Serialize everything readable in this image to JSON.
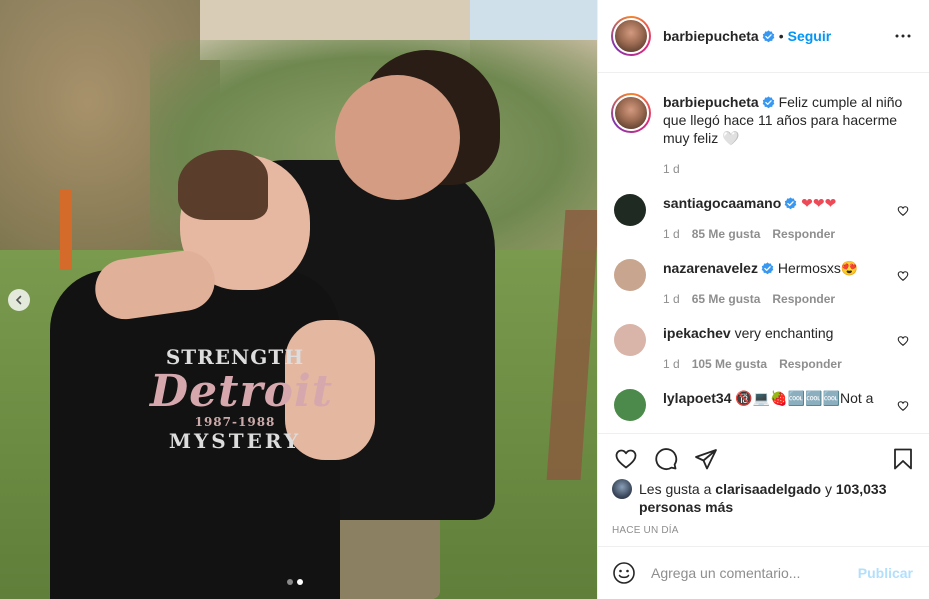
{
  "post": {
    "author": "barbiepucheta",
    "follow_label": "Seguir",
    "separator": "•",
    "caption": "Feliz cumple al niño que llegó hace 11 años para hacerme muy feliz 🤍",
    "caption_time": "1 d",
    "photo": {
      "shirt_line1": "STRENGTH",
      "shirt_line2": "Detroit",
      "shirt_line3": "1987-1988",
      "shirt_line4": "MYSTERY",
      "current_slide": 2,
      "total_slides": 2
    }
  },
  "comments": [
    {
      "user": "santiagocaamano",
      "verified": true,
      "text": "❤❤❤",
      "time": "1 d",
      "likes": "85 Me gusta",
      "reply": "Responder",
      "avatar_color": "#1f2a22"
    },
    {
      "user": "nazarenavelez",
      "verified": true,
      "text": "Hermosxs😍",
      "time": "1 d",
      "likes": "65 Me gusta",
      "reply": "Responder",
      "avatar_color": "#c8a58e"
    },
    {
      "user": "ipekachev",
      "verified": false,
      "text": "very enchanting",
      "time": "1 d",
      "likes": "105 Me gusta",
      "reply": "Responder",
      "avatar_color": "#d9b4a8"
    },
    {
      "user": "lylapoet34",
      "verified": false,
      "text": "🔞💻🍓🆒🆒🆒Not a",
      "time": "",
      "likes": "",
      "reply": "",
      "avatar_color": "#4b8a4a"
    }
  ],
  "likes": {
    "prefix": "Les gusta a",
    "user": "clarisaadelgado",
    "connector": "y",
    "count": "103,033 personas más"
  },
  "timestamp": "Hace un día",
  "add_comment": {
    "placeholder": "Agrega un comentario...",
    "publish_label": "Publicar"
  },
  "colors": {
    "accent": "#0095f6",
    "publish_disabled": "#b2dffc",
    "heart_red": "#ed4956",
    "muted": "#8e8e8e"
  },
  "icons": [
    "chevron-left-icon",
    "more-icon",
    "verified-icon",
    "heart-icon",
    "comment-icon",
    "share-icon",
    "bookmark-icon",
    "emoji-icon"
  ]
}
